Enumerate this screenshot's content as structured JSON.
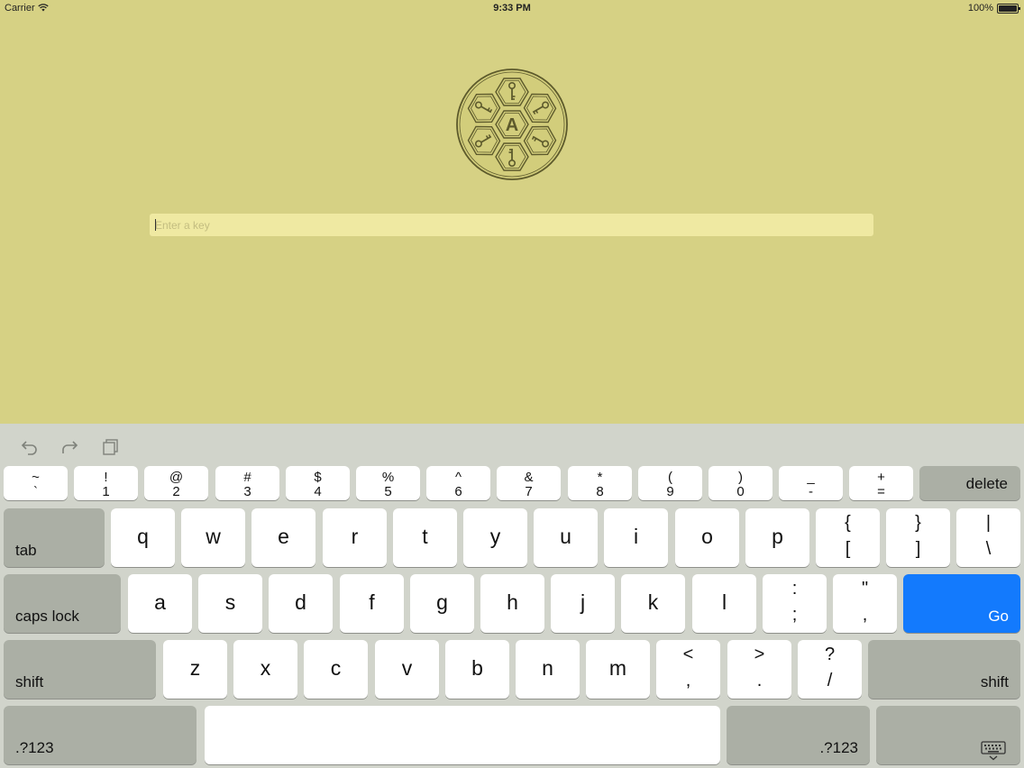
{
  "status_bar": {
    "carrier": "Carrier",
    "time": "9:33 PM",
    "battery": "100%"
  },
  "logo": {
    "letter": "A"
  },
  "key_field": {
    "value": "",
    "placeholder": "Enter a key"
  },
  "keyboard": {
    "number_row": [
      {
        "top": "~",
        "bottom": "`"
      },
      {
        "top": "!",
        "bottom": "1"
      },
      {
        "top": "@",
        "bottom": "2"
      },
      {
        "top": "#",
        "bottom": "3"
      },
      {
        "top": "$",
        "bottom": "4"
      },
      {
        "top": "%",
        "bottom": "5"
      },
      {
        "top": "^",
        "bottom": "6"
      },
      {
        "top": "&",
        "bottom": "7"
      },
      {
        "top": "*",
        "bottom": "8"
      },
      {
        "top": "(",
        "bottom": "9"
      },
      {
        "top": ")",
        "bottom": "0"
      },
      {
        "top": "_",
        "bottom": "-"
      },
      {
        "top": "+",
        "bottom": "="
      }
    ],
    "delete_label": "delete",
    "tab_label": "tab",
    "row1": [
      "q",
      "w",
      "e",
      "r",
      "t",
      "y",
      "u",
      "i",
      "o",
      "p"
    ],
    "row1_symbols": [
      {
        "top": "{",
        "bottom": "["
      },
      {
        "top": "}",
        "bottom": "]"
      },
      {
        "top": "|",
        "bottom": "\\"
      }
    ],
    "caps_label": "caps lock",
    "row2": [
      "a",
      "s",
      "d",
      "f",
      "g",
      "h",
      "j",
      "k",
      "l"
    ],
    "row2_symbols": [
      {
        "top": ":",
        "bottom": ";"
      },
      {
        "top": "\"",
        "bottom": ","
      }
    ],
    "go_label": "Go",
    "shift_label": "shift",
    "row3": [
      "z",
      "x",
      "c",
      "v",
      "b",
      "n",
      "m"
    ],
    "row3_symbols": [
      {
        "top": "<",
        "bottom": ","
      },
      {
        "top": ">",
        "bottom": "."
      },
      {
        "top": "?",
        "bottom": "/"
      }
    ],
    "numbers_label": ".?123",
    "accent_color": "#137afd",
    "toolbar_icons": [
      "undo-icon",
      "redo-icon",
      "paste-icon"
    ]
  }
}
